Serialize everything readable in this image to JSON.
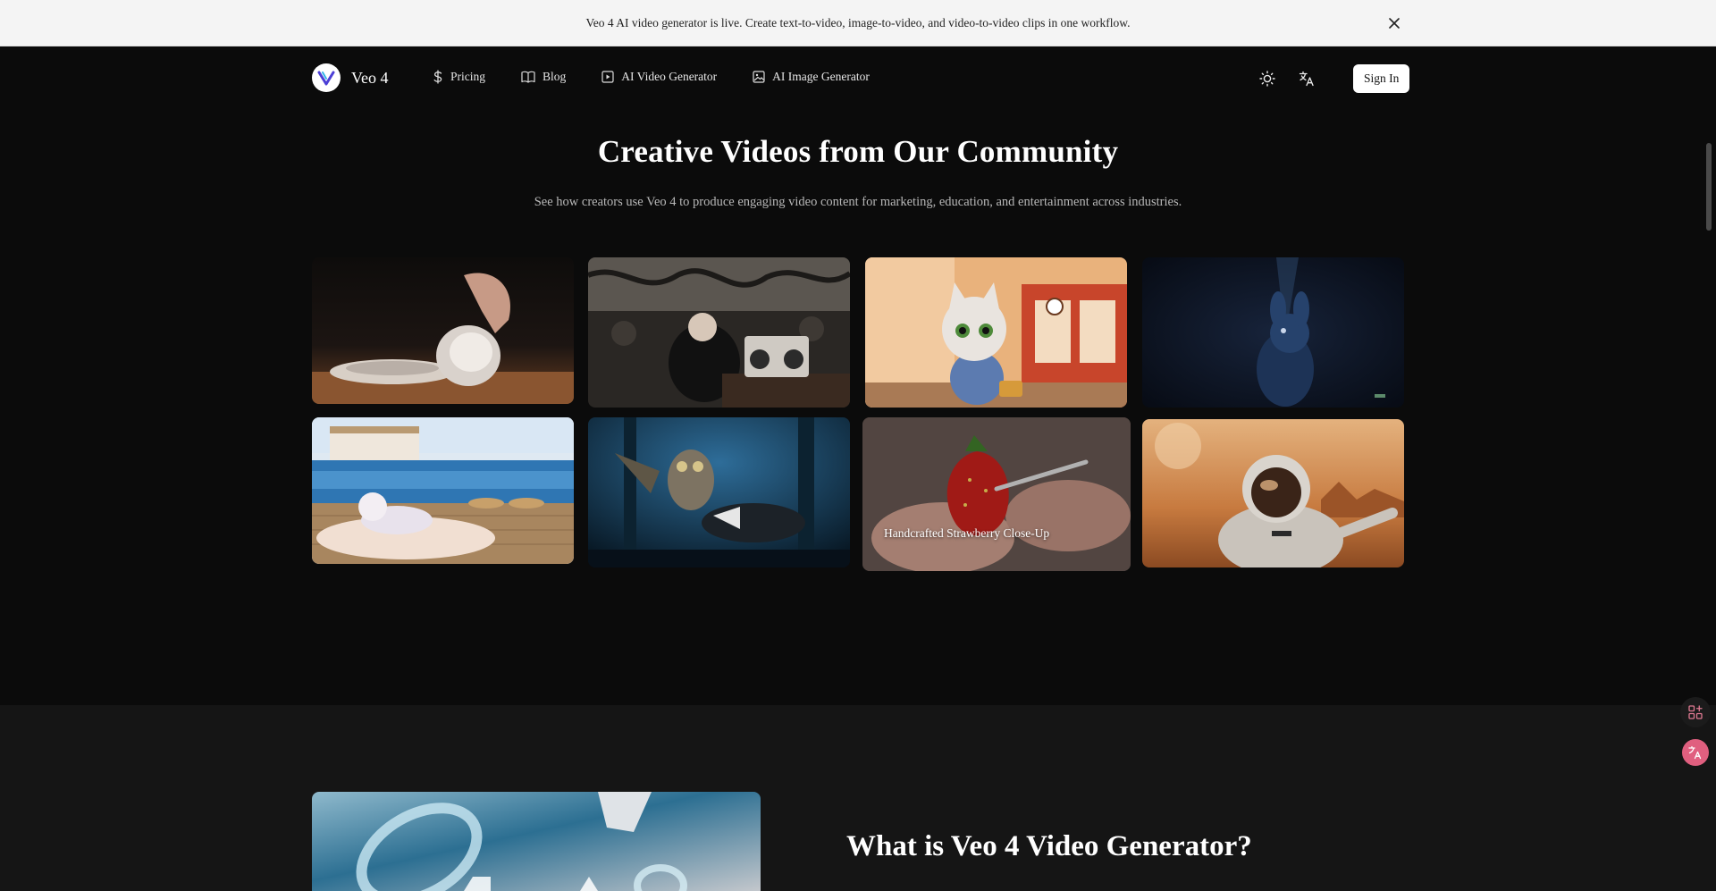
{
  "banner": {
    "text": "Veo 4 AI video generator is live. Create text-to-video, image-to-video, and video-to-video clips in one workflow."
  },
  "nav": {
    "brand": "Veo 4",
    "links": [
      {
        "label": "Pricing",
        "icon": "dollar-icon"
      },
      {
        "label": "Blog",
        "icon": "book-icon"
      },
      {
        "label": "AI Video Generator",
        "icon": "video-icon"
      },
      {
        "label": "AI Image Generator",
        "icon": "image-icon"
      }
    ],
    "sign_in": "Sign In"
  },
  "community": {
    "title": "Creative Videos from Our Community",
    "subtitle": "See how creators use Veo 4 to produce engaging video content for marketing, education, and entertainment across industries.",
    "featured_caption": "Handcrafted Strawberry Close-Up"
  },
  "about": {
    "title": "What is Veo 4 Video Generator?"
  },
  "colors": {
    "page_bg": "#0b0b0b",
    "banner_bg": "#f4f4f4",
    "lower_bg": "#151515",
    "translate_accent": "#e05f7f"
  }
}
